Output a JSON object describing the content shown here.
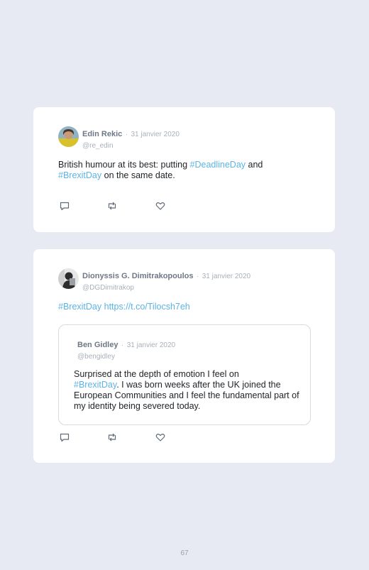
{
  "tweets": [
    {
      "author": "Edin Rekic",
      "separator": "·",
      "date": "31 janvier 2020",
      "handle": "@re_edin",
      "text": {
        "p1": "British humour at its best: putting ",
        "link1": "#DeadlineDay",
        "p2": " and ",
        "link2": "#BrexitDay",
        "p3": " on the same date."
      },
      "actions": [
        "reply-icon",
        "retweet-icon",
        "like-icon"
      ]
    },
    {
      "author": "Dionyssis G. Dimitrakopoulos",
      "separator": "·",
      "date": "31 janvier 2020",
      "handle": "@DGDimitrakop",
      "text": {
        "link1": "#BrexitDay",
        "link2": "https://t.co/Tilocsh7eh"
      },
      "quoted": {
        "author": "Ben Gidley",
        "separator": "·",
        "date": "31 janvier 2020",
        "handle": "@bengidley",
        "text": {
          "p1": "Surprised at the depth of emotion I feel on",
          "link1": "#BrexitDay",
          "p2": ". I was born weeks after the UK joined the European Communities and I feel the fundamental part of my identity being severed today."
        }
      },
      "actions": [
        "reply-icon",
        "retweet-icon",
        "like-icon"
      ]
    }
  ],
  "page_number": "67",
  "colors": {
    "background": "#e8eaf3",
    "card": "#ffffff",
    "link": "#5bb4e6",
    "name": "#6e7785",
    "muted": "#a9b0ba",
    "text": "#1e2226"
  }
}
